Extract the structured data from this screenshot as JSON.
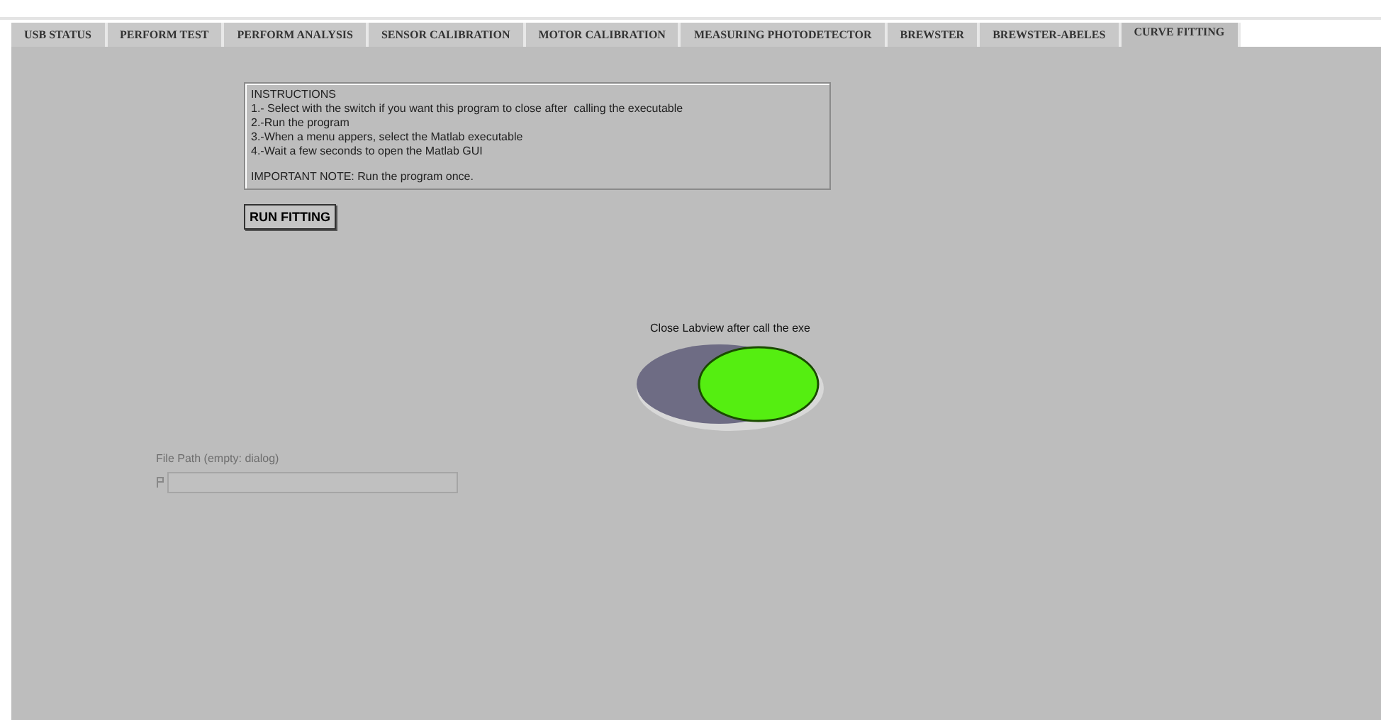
{
  "tabs": [
    {
      "label": "USB STATUS",
      "selected": false
    },
    {
      "label": "PERFORM TEST",
      "selected": false
    },
    {
      "label": "PERFORM ANALYSIS",
      "selected": false
    },
    {
      "label": "SENSOR CALIBRATION",
      "selected": false
    },
    {
      "label": "MOTOR CALIBRATION",
      "selected": false
    },
    {
      "label": "MEASURING PHOTODETECTOR",
      "selected": false
    },
    {
      "label": "BREWSTER",
      "selected": false
    },
    {
      "label": "BREWSTER-ABELES",
      "selected": false
    },
    {
      "label": "CURVE FITTING",
      "selected": true
    }
  ],
  "instructions": {
    "title": "INSTRUCTIONS",
    "lines": [
      "1.- Select with the switch if you want this program to close after  calling the executable",
      "2.-Run the program",
      "3.-When a menu appers, select the Matlab executable",
      "4.-Wait a few seconds to open the Matlab GUI"
    ],
    "note": "IMPORTANT NOTE: Run the program once."
  },
  "run_button": {
    "label": "RUN FITTING"
  },
  "switch": {
    "label": "Close Labview after call the exe",
    "on": true
  },
  "file_path": {
    "label": "File Path (empty: dialog)",
    "disabled": true
  }
}
